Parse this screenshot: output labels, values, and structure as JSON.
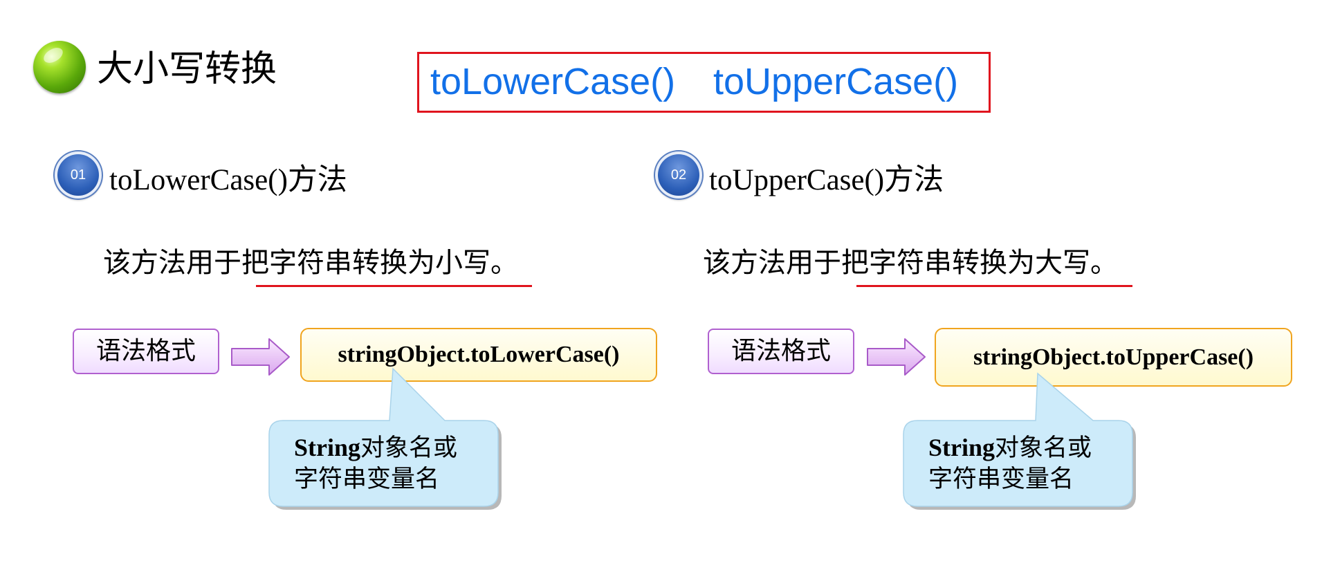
{
  "title": "大小写转换",
  "methods": {
    "lower": "toLowerCase()",
    "upper": "toUpperCase()"
  },
  "sections": [
    {
      "badge": "01",
      "heading": "toLowerCase()方法",
      "desc_before": "该方法用于",
      "desc_underlined": "把字符串转换为小写",
      "desc_after": "。",
      "syntax_label": "语法格式",
      "code": "stringObject.toLowerCase()",
      "callout_bold": "String",
      "callout_rest": "对象名或",
      "callout_line2": "字符串变量名"
    },
    {
      "badge": "02",
      "heading": "toUpperCase()方法",
      "desc_before": "该方法用于",
      "desc_underlined": "把字符串转换为大写",
      "desc_after": "。",
      "syntax_label": "语法格式",
      "code": "stringObject.toUpperCase()",
      "callout_bold": "String",
      "callout_rest": "对象名或",
      "callout_line2": "字符串变量名"
    }
  ],
  "colors": {
    "method_text": "#1270e8",
    "highlight_border": "#e0141e",
    "syntax_border": "#b060cf",
    "code_border": "#f0a41e",
    "callout_fill": "#cdebfa"
  }
}
